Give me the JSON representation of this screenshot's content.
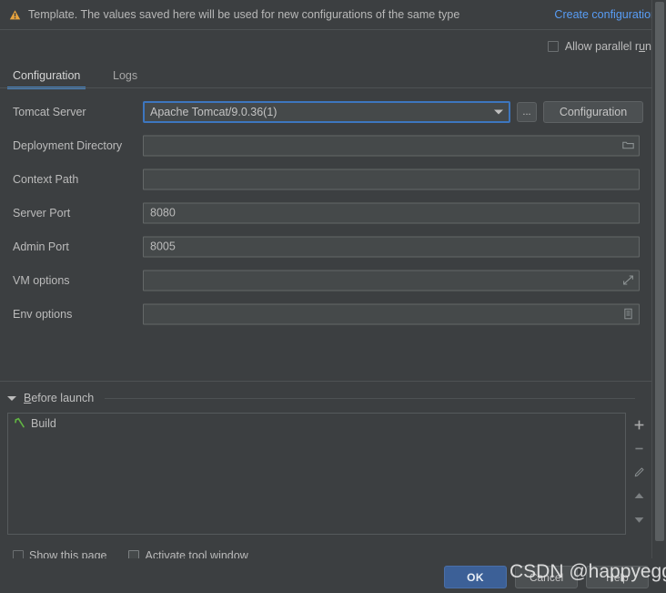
{
  "banner": {
    "icon": "warning-triangle-icon",
    "message": "Template. The values saved here will be used for new configurations of the same type",
    "link_label": "Create configuration"
  },
  "options": {
    "allow_parallel_run_label": "Allow parallel r",
    "allow_parallel_run_mnemonic": "u",
    "allow_parallel_run_tail": "n",
    "allow_parallel_run_checked": false
  },
  "tabs": [
    {
      "label": "Configuration",
      "active": true
    },
    {
      "label": "Logs",
      "active": false
    }
  ],
  "form": {
    "rows": [
      {
        "label": "Tomcat Server",
        "value": "Apache Tomcat/9.0.36(1)",
        "type": "combo"
      },
      {
        "label": "Deployment Directory",
        "value": "",
        "type": "text",
        "icon": "folder-icon"
      },
      {
        "label": "Context Path",
        "value": "",
        "type": "text",
        "icon": ""
      },
      {
        "label": "Server Port",
        "value": "8080",
        "type": "text",
        "icon": ""
      },
      {
        "label": "Admin Port",
        "value": "8005",
        "type": "text",
        "icon": ""
      },
      {
        "label": "VM options",
        "value": "",
        "type": "text",
        "icon": "expand-icon"
      },
      {
        "label": "Env options",
        "value": "",
        "type": "text",
        "icon": "list-icon"
      }
    ],
    "ellipsis_button_label": "...",
    "configuration_button_label": "Configuration"
  },
  "before_launch": {
    "title_mnemonic": "B",
    "title_rest": "efore launch",
    "expanded": true,
    "tasks": [
      {
        "label": "Build",
        "icon": "hammer-icon"
      }
    ],
    "toolbar": [
      {
        "name": "add-task-button",
        "icon": "plus-icon"
      },
      {
        "name": "remove-task-button",
        "icon": "minus-icon"
      },
      {
        "name": "edit-task-button",
        "icon": "pencil-icon"
      },
      {
        "name": "move-task-up-button",
        "icon": "arrow-up-icon"
      },
      {
        "name": "move-task-down-button",
        "icon": "arrow-down-icon"
      }
    ]
  },
  "bottom_checks": [
    {
      "label": "Show this page",
      "checked": false
    },
    {
      "label": "Activate tool window",
      "checked": true
    }
  ],
  "footer": {
    "ok_label": "OK",
    "cancel_label": "Cancel",
    "help_label": "Help"
  },
  "watermark": {
    "text": "CSDN @happyegg"
  },
  "colors": {
    "background": "#3c3f41",
    "field_background": "#45494a",
    "accent_blue": "#4a88c7",
    "link_blue": "#589df6",
    "ok_button": "#3c6097",
    "warning_amber": "#e8a33d",
    "build_green": "#62b543"
  }
}
